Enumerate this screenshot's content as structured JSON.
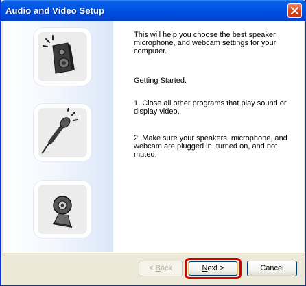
{
  "window": {
    "title": "Audio and Video Setup"
  },
  "content": {
    "intro": "This will help you choose the best speaker, microphone, and webcam settings for your computer.",
    "heading": "Getting Started:",
    "step1": "1. Close all other programs that play sound or display video.",
    "step2": "2. Make sure your speakers, microphone, and webcam are plugged in, turned on, and not muted."
  },
  "buttons": {
    "back": {
      "prefix": "< ",
      "mnemonic": "B",
      "rest": "ack"
    },
    "next": {
      "mnemonic": "N",
      "rest": "ext >"
    },
    "cancel": "Cancel"
  },
  "colors": {
    "titlebar": "#0055e5",
    "highlight": "#d90000"
  },
  "icons": [
    "speaker-icon",
    "microphone-icon",
    "webcam-icon",
    "close-icon"
  ]
}
